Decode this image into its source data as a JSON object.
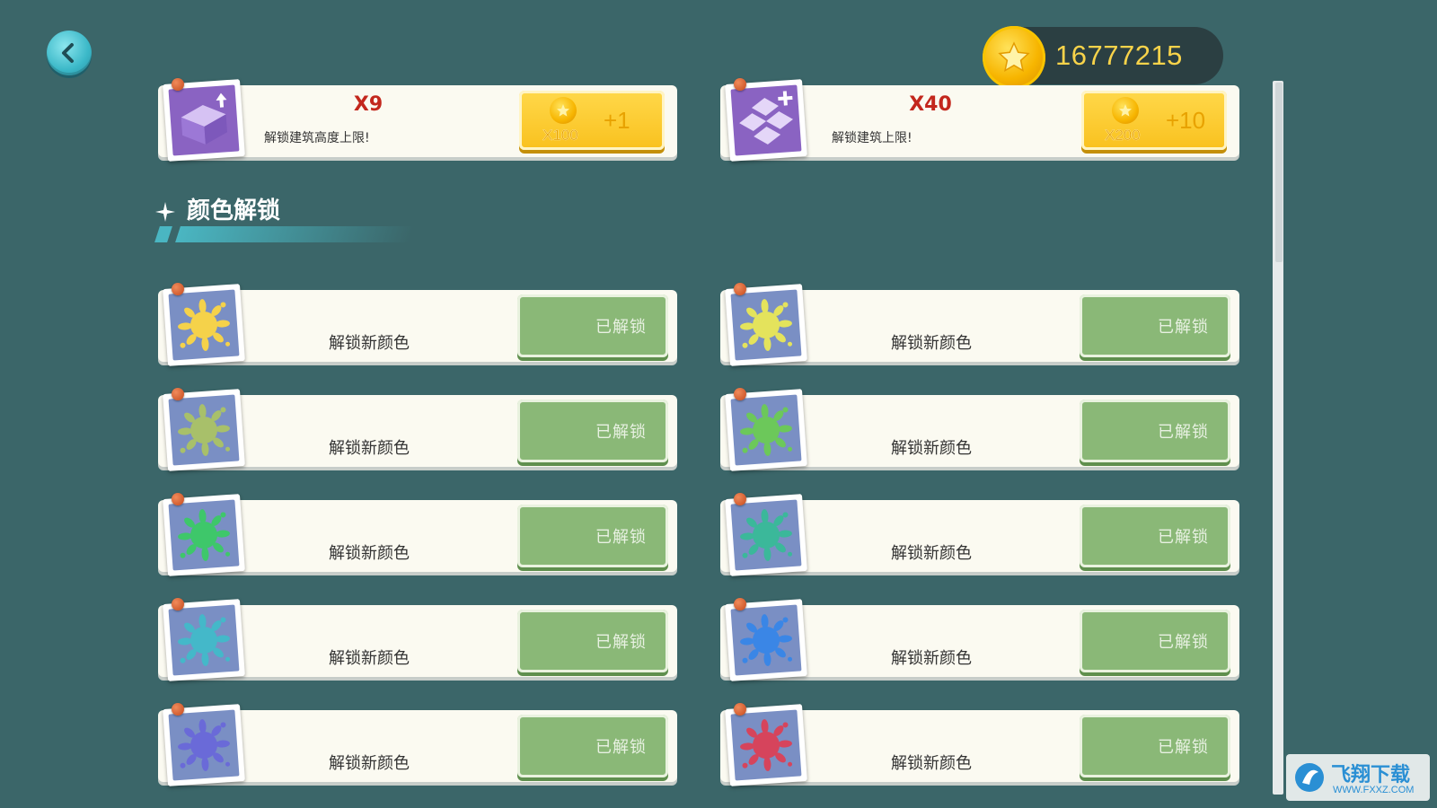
{
  "coins": {
    "value": "16777215"
  },
  "upgrades": [
    {
      "multiplier": "X9",
      "description": "解锁建筑高度上限!",
      "cost": "X100",
      "gain": "+1"
    },
    {
      "multiplier": "X40",
      "description": "解锁建筑上限!",
      "cost": "X200",
      "gain": "+10"
    }
  ],
  "section": {
    "title": "颜色解锁"
  },
  "colors": [
    {
      "description": "解锁新颜色",
      "button": "已解锁",
      "swatch": "#f5d24a"
    },
    {
      "description": "解锁新颜色",
      "button": "已解锁",
      "swatch": "#e4e35c"
    },
    {
      "description": "解锁新颜色",
      "button": "已解锁",
      "swatch": "#a8c06a"
    },
    {
      "description": "解锁新颜色",
      "button": "已解锁",
      "swatch": "#6cc85a"
    },
    {
      "description": "解锁新颜色",
      "button": "已解锁",
      "swatch": "#3ec76a"
    },
    {
      "description": "解锁新颜色",
      "button": "已解锁",
      "swatch": "#3bb89a"
    },
    {
      "description": "解锁新颜色",
      "button": "已解锁",
      "swatch": "#44b8c9"
    },
    {
      "description": "解锁新颜色",
      "button": "已解锁",
      "swatch": "#3a86e6"
    },
    {
      "description": "解锁新颜色",
      "button": "已解锁",
      "swatch": "#6a6ad8"
    },
    {
      "description": "解锁新颜色",
      "button": "已解锁",
      "swatch": "#d6445c"
    }
  ],
  "watermark": {
    "title": "飞翔下载",
    "url": "WWW.FXXZ.COM"
  },
  "icons": {
    "back": "back-arrow-icon",
    "coin": "star-coin-icon",
    "sparkle": "sparkle-icon",
    "paint": "paint-splat-icon"
  }
}
